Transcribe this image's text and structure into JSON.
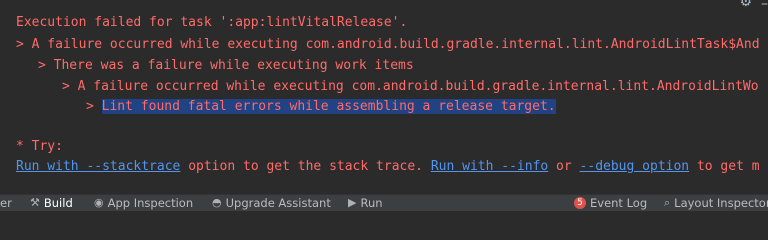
{
  "console": {
    "lines": [
      "Execution failed for task ':app:lintVitalRelease'.",
      "> A failure occurred while executing com.android.build.gradle.internal.lint.AndroidLintTask$And",
      "> There was a failure while executing work items",
      "> A failure occurred while executing com.android.build.gradle.internal.lint.AndroidLintWo",
      "> ",
      "Lint found fatal errors while assembling a release target.",
      "* Try:"
    ],
    "try_line": {
      "link1": "Run with --stacktrace",
      "text1": " option to get the stack trace. ",
      "link2": "Run with --info",
      "text2": " or ",
      "link3": "--debug option",
      "text3": " to get m"
    }
  },
  "toolwindow_tabs": [
    {
      "label": "er",
      "icon": ""
    },
    {
      "label": "Build",
      "icon": "hammer-icon"
    },
    {
      "label": "App Inspection",
      "icon": "inspection-icon"
    },
    {
      "label": "Upgrade Assistant",
      "icon": "turtle-icon"
    },
    {
      "label": "Run",
      "icon": "run-icon"
    },
    {
      "label": "Event Log",
      "icon": "event-log-icon",
      "badge": "5"
    },
    {
      "label": "Layout Inspector",
      "icon": "layout-inspector-icon"
    }
  ],
  "colors": {
    "error_text": "#ff6b68",
    "link": "#5394ec",
    "selection": "#214283",
    "background": "#2b2b2b"
  }
}
